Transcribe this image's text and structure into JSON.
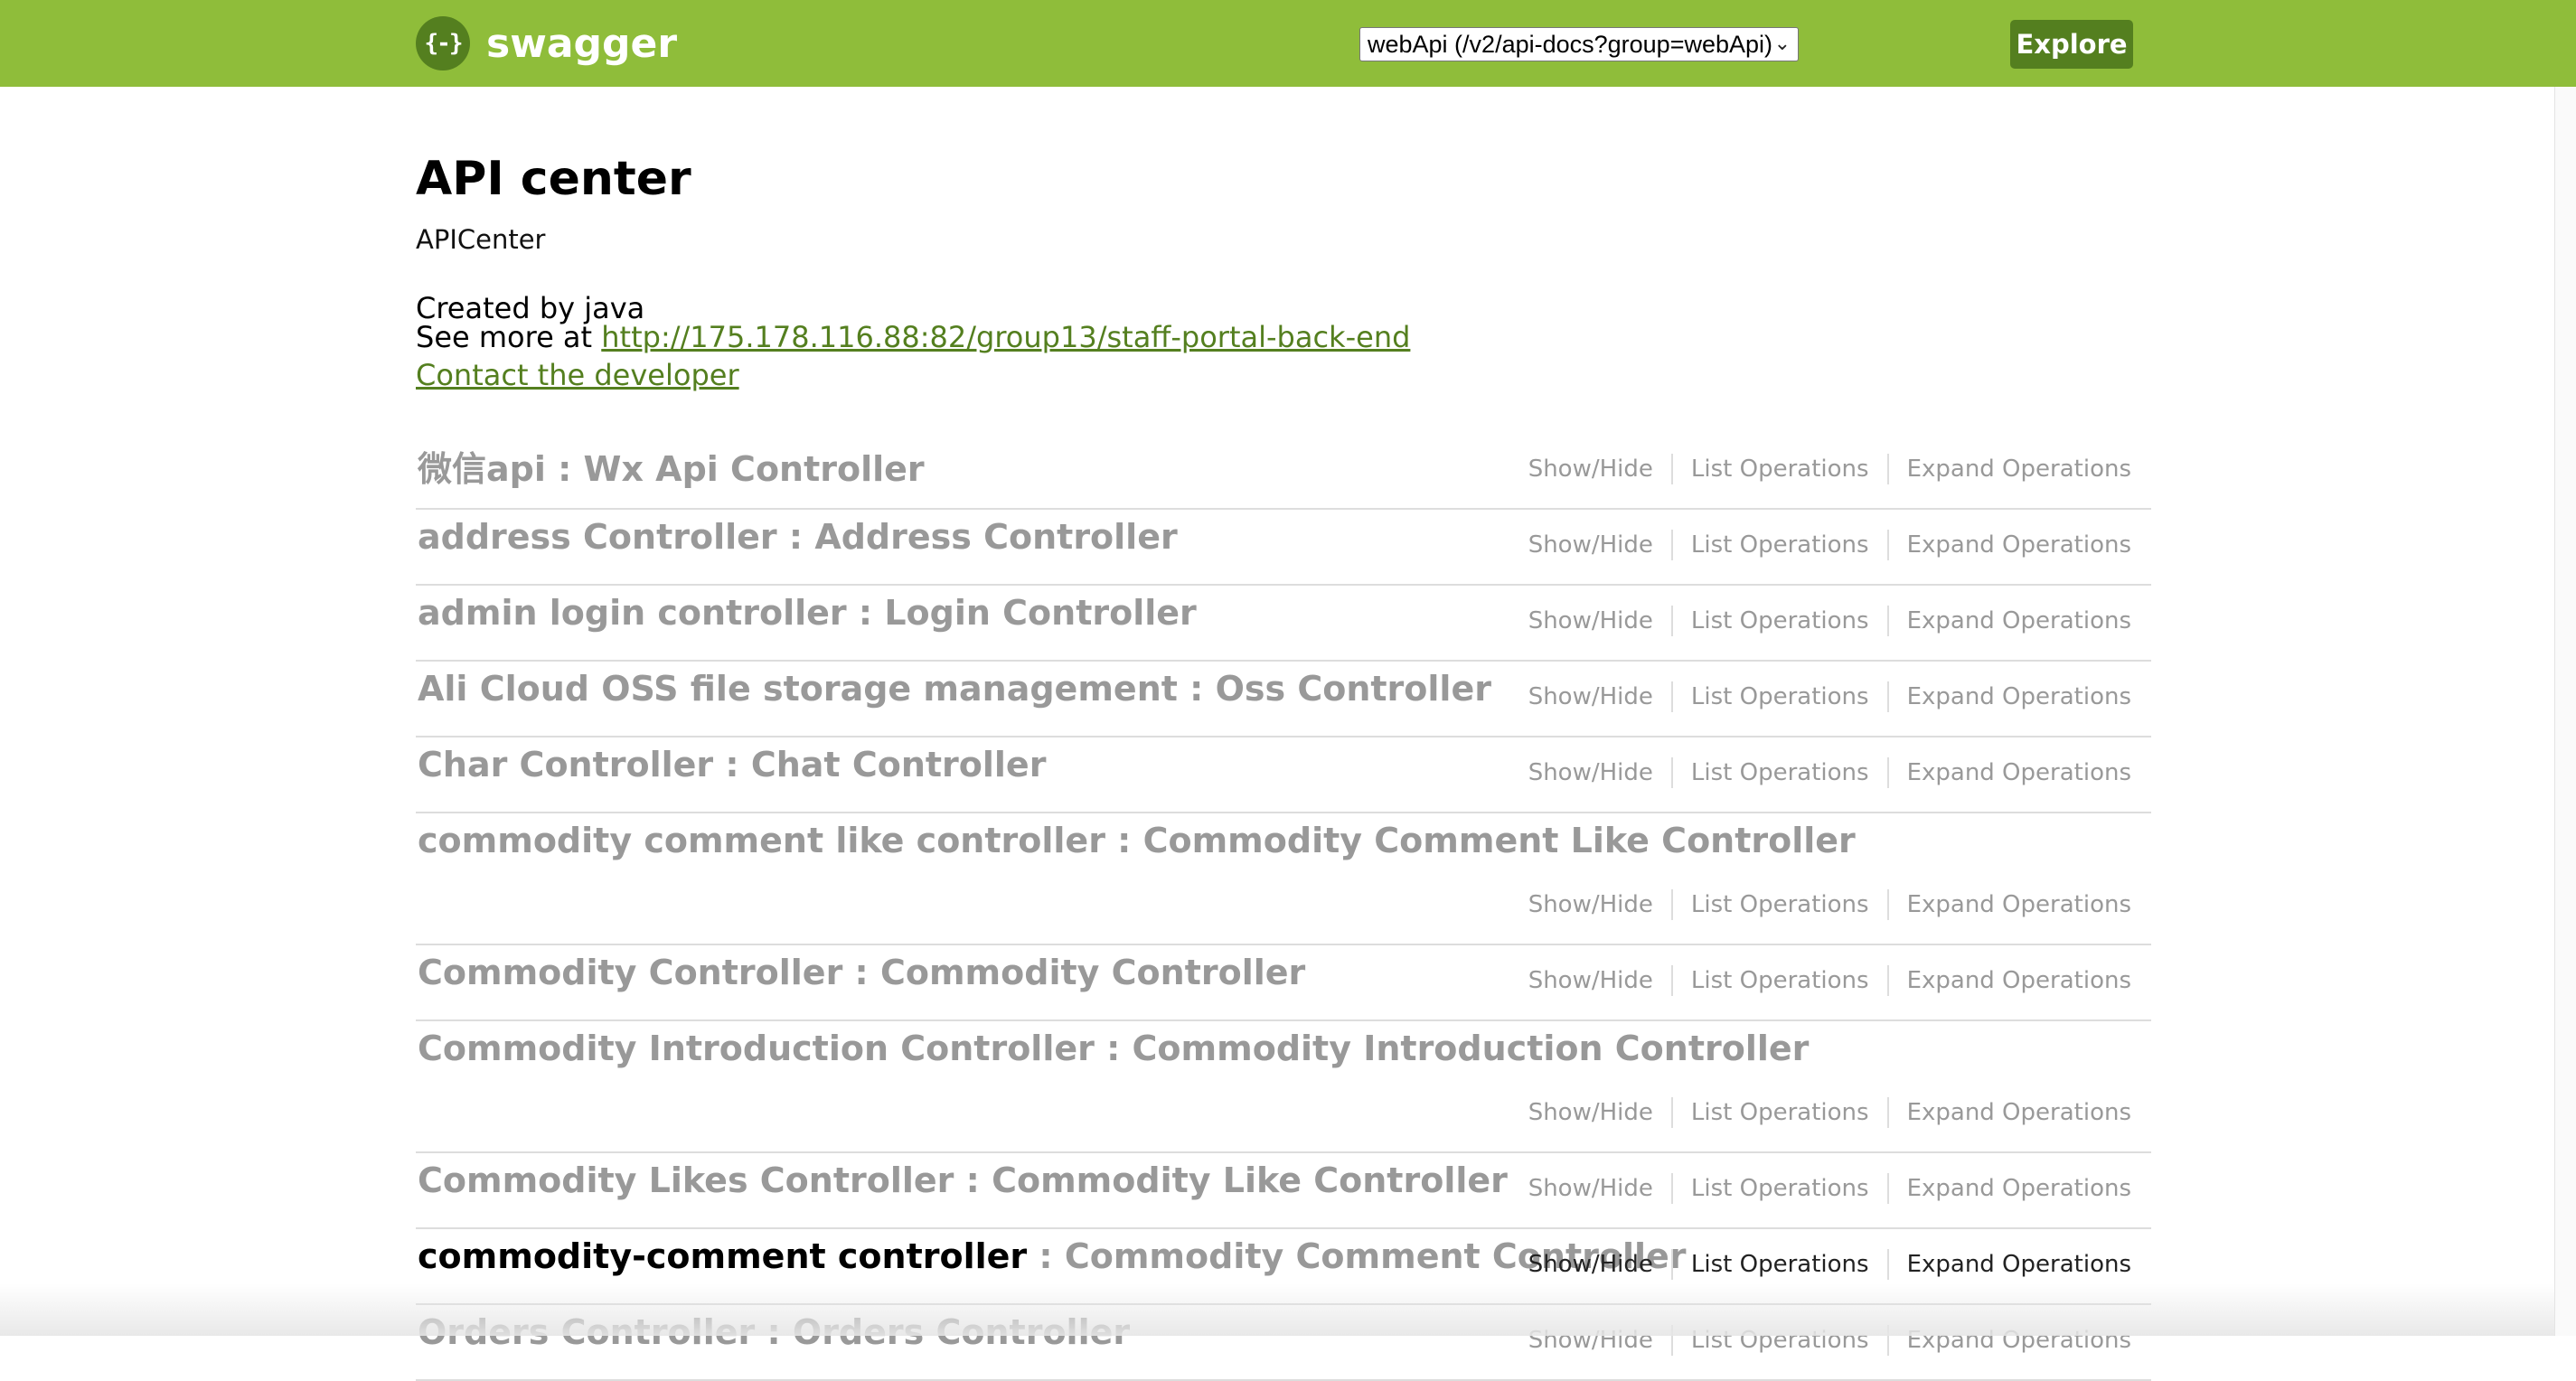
{
  "header": {
    "logo_glyph": "{-}",
    "logo_text": "swagger",
    "api_select_value": "webApi (/v2/api-docs?group=webApi)",
    "explore_label": "Explore",
    "colors": {
      "header_bg": "#8fbd3a",
      "logo_dark": "#547f1f",
      "link": "#547f1f"
    }
  },
  "info": {
    "title": "API center",
    "description": "APICenter",
    "created_by": "Created by java",
    "see_more_prefix": "See more at ",
    "see_more_url": "http://175.178.116.88:82/group13/staff-portal-back-end",
    "contact_label": "Contact the developer"
  },
  "operations": {
    "show_hide": "Show/Hide",
    "list_ops": "List Operations",
    "expand_ops": "Expand Operations"
  },
  "resources": [
    {
      "name": "微信api",
      "sep": " : ",
      "desc": "Wx Api Controller"
    },
    {
      "name": "address Controller",
      "sep": " : ",
      "desc": "Address Controller"
    },
    {
      "name": "admin login controller",
      "sep": " : ",
      "desc": "Login Controller"
    },
    {
      "name": "Ali Cloud OSS file storage management",
      "sep": " : ",
      "desc": "Oss Controller"
    },
    {
      "name": "Char Controller",
      "sep": " : ",
      "desc": "Chat Controller"
    },
    {
      "name": "commodity comment like controller",
      "sep": " : ",
      "desc": "Commodity Comment Like Controller"
    },
    {
      "name": "Commodity Controller",
      "sep": " : ",
      "desc": "Commodity Controller"
    },
    {
      "name": "Commodity Introduction Controller",
      "sep": " : ",
      "desc": "Commodity Introduction Controller"
    },
    {
      "name": "Commodity Likes Controller",
      "sep": " : ",
      "desc": "Commodity Like Controller"
    },
    {
      "name": "commodity-comment controller",
      "sep": " : ",
      "desc": "Commodity Comment Controller"
    },
    {
      "name": "Orders Controller",
      "sep": " : ",
      "desc": "Orders Controller"
    }
  ]
}
